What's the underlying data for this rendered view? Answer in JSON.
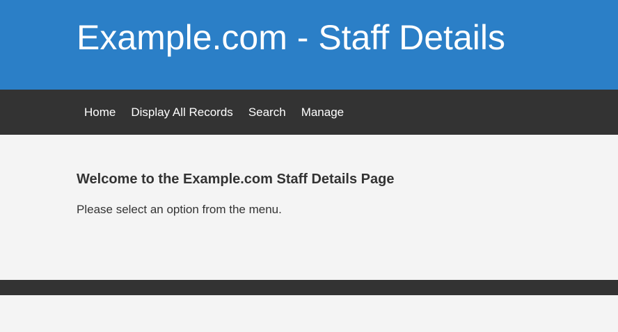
{
  "header": {
    "title": "Example.com - Staff Details"
  },
  "nav": {
    "items": [
      {
        "label": "Home"
      },
      {
        "label": "Display All Records"
      },
      {
        "label": "Search"
      },
      {
        "label": "Manage"
      }
    ]
  },
  "main": {
    "heading": "Welcome to the Example.com Staff Details Page",
    "intro": "Please select an option from the menu."
  },
  "colors": {
    "header_bg": "#2b7fc7",
    "nav_bg": "#333333",
    "page_bg": "#f4f4f4"
  }
}
